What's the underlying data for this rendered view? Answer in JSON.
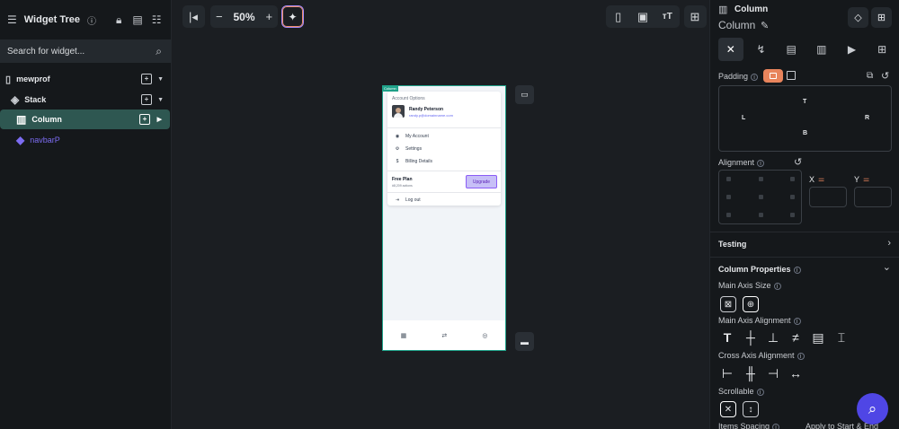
{
  "left_panel": {
    "title": "Widget Tree",
    "search_placeholder": "Search for widget...",
    "tree": [
      {
        "label": "mewprof",
        "icon": "phone-icon"
      },
      {
        "label": "Stack",
        "icon": "layers-icon"
      },
      {
        "label": "Column",
        "icon": "column-icon",
        "selected": true
      },
      {
        "label": "navbarP",
        "icon": "component-icon",
        "color": "#7c6cf2"
      }
    ]
  },
  "canvas": {
    "zoom": "50%",
    "phone": {
      "tag": "Column",
      "card_title": "Account Options",
      "user_name": "Randy Peterson",
      "user_email": "randy.p@domainname.com",
      "menu": [
        "My Account",
        "Settings",
        "Billing Details"
      ],
      "plan_title": "Free Plan",
      "plan_sub": "#8,209 actions",
      "upgrade_label": "Upgrade",
      "logout_label": "Log out"
    }
  },
  "right_panel": {
    "widget_name": "Column",
    "widget_sub_name": "Column",
    "padding_label": "Padding",
    "padding_sides": {
      "top": "T",
      "left": "L",
      "right": "R",
      "bottom": "B"
    },
    "alignment_label": "Alignment",
    "x_label": "X",
    "y_label": "Y",
    "testing_label": "Testing",
    "column_props_label": "Column Properties",
    "main_axis_size_label": "Main Axis Size",
    "main_axis_alignment_label": "Main Axis Alignment",
    "cross_axis_alignment_label": "Cross Axis Alignment",
    "scrollable_label": "Scrollable",
    "items_spacing_label": "Items Spacing",
    "apply_label": "Apply to Start & End"
  },
  "colors": {
    "accent": "#4f46e5",
    "selected_row": "#2e5751",
    "padding_toggle": "#e8845c",
    "phone_border": "#1fa28a"
  }
}
